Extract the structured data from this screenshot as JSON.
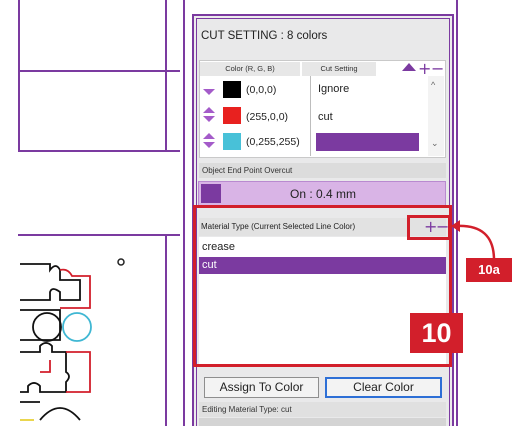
{
  "panel": {
    "title": "CUT SETTING : 8 colors",
    "color_table": {
      "col_color": "Color (R, G, B)",
      "col_cut": "Cut Setting",
      "rows": [
        {
          "swatch": "#000000",
          "rgb": "(0,0,0)",
          "cut": "Ignore"
        },
        {
          "swatch": "#e8211f",
          "rgb": "(255,0,0)",
          "cut": "cut"
        },
        {
          "swatch": "#48c1d8",
          "rgb": "(0,255,255)",
          "cut": ""
        }
      ],
      "add_label": "+",
      "remove_label": "−"
    },
    "overcut": {
      "section_label": "Object End Point Overcut",
      "value": "On : 0.4 mm"
    },
    "material": {
      "section_label": "Material Type (Current Selected Line Color)",
      "add_label": "+",
      "remove_label": "−",
      "items": [
        "crease",
        "cut"
      ],
      "selected": "cut"
    },
    "buttons": {
      "assign": "Assign To Color",
      "clear": "Clear Color"
    },
    "editing_label": "Editing Material Type: cut"
  },
  "callouts": {
    "label_10": "10",
    "label_10a": "10a"
  },
  "colors": {
    "accent": "#7b3aa0",
    "selection": "#7b3aa0",
    "callout_red": "#d21f2b",
    "overcut_bg": "#d9b4e6"
  }
}
